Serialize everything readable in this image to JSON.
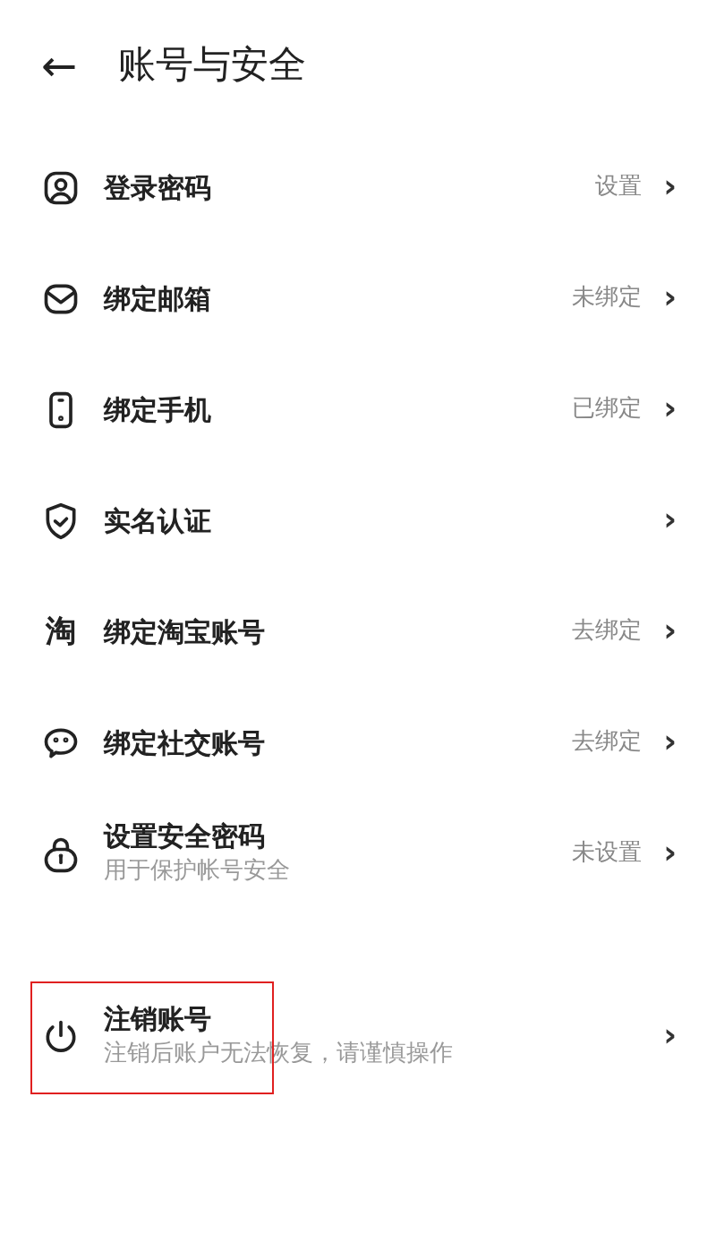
{
  "header": {
    "back": "←",
    "title": "账号与安全"
  },
  "items": [
    {
      "kind": "user",
      "label": "登录密码",
      "value": "设置",
      "highlighted": false
    },
    {
      "kind": "mail",
      "label": "绑定邮箱",
      "value": "未绑定",
      "highlighted": false
    },
    {
      "kind": "phone",
      "label": "绑定手机",
      "value": "已绑定",
      "highlighted": false
    },
    {
      "kind": "shield",
      "label": "实名认证",
      "highlighted": false
    },
    {
      "kind": "glyph",
      "glyph": "淘",
      "label": "绑定淘宝账号",
      "value": "去绑定",
      "highlighted": false
    },
    {
      "kind": "chat",
      "label": "绑定社交账号",
      "value": "去绑定",
      "highlighted": false
    },
    {
      "kind": "lock",
      "label": "设置安全密码",
      "subtitle": "用于保护帐号安全",
      "value": "未设置",
      "highlighted": false
    },
    {
      "kind": "power",
      "label": "注销账号",
      "subtitle": "注销后账户无法恢复，请谨慎操作",
      "highlighted": true
    }
  ],
  "chevron": "›"
}
